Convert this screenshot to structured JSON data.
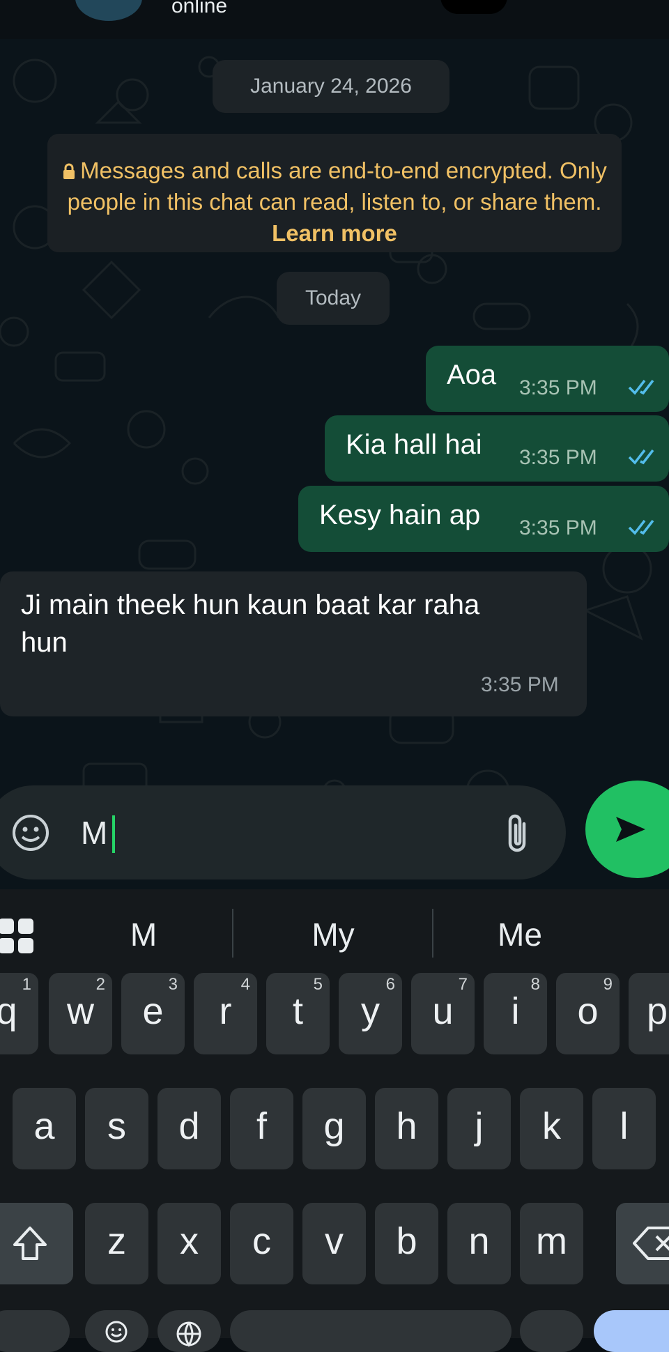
{
  "header": {
    "status": "online"
  },
  "chat": {
    "date_separator": "January 24, 2026",
    "today_separator": "Today",
    "encryption": {
      "text": "Messages and calls are end-to-end encrypted. Only people in this chat can read, listen to, or share them.",
      "link": "Learn more",
      "icon": "lock-icon"
    },
    "messages": [
      {
        "direction": "outgoing",
        "text": "Aoa",
        "time": "3:35 PM",
        "status": "read"
      },
      {
        "direction": "outgoing",
        "text": "Kia hall hai",
        "time": "3:35 PM",
        "status": "read"
      },
      {
        "direction": "outgoing",
        "text": "Kesy hain ap",
        "time": "3:35 PM",
        "status": "read"
      },
      {
        "direction": "incoming",
        "text_line1": "Ji main theek hun kaun baat kar raha",
        "text_line2": "hun",
        "time": "3:35 PM"
      }
    ]
  },
  "composer": {
    "value": "M",
    "icons": {
      "emoji": "sticker-emoji-icon",
      "attach": "paperclip-icon",
      "send": "send-icon"
    }
  },
  "keyboard": {
    "suggestions": [
      "M",
      "My",
      "Me"
    ],
    "row1": [
      {
        "key": "q",
        "num": "1"
      },
      {
        "key": "w",
        "num": "2"
      },
      {
        "key": "e",
        "num": "3"
      },
      {
        "key": "r",
        "num": "4"
      },
      {
        "key": "t",
        "num": "5"
      },
      {
        "key": "y",
        "num": "6"
      },
      {
        "key": "u",
        "num": "7"
      },
      {
        "key": "i",
        "num": "8"
      },
      {
        "key": "o",
        "num": "9"
      },
      {
        "key": "p",
        "num": ""
      }
    ],
    "row2": [
      "a",
      "s",
      "d",
      "f",
      "g",
      "h",
      "j",
      "k",
      "l"
    ],
    "row3": [
      "z",
      "x",
      "c",
      "v",
      "b",
      "n",
      "m"
    ],
    "icons": {
      "apps": "apps-grid-icon",
      "shift": "shift-icon",
      "backspace": "backspace-icon"
    }
  },
  "colors": {
    "outgoing_bubble": "#144d37",
    "incoming_bubble": "#1e2428",
    "send_button": "#21c063",
    "read_ticks": "#53bdeb",
    "encryption_text": "#f1c165"
  }
}
